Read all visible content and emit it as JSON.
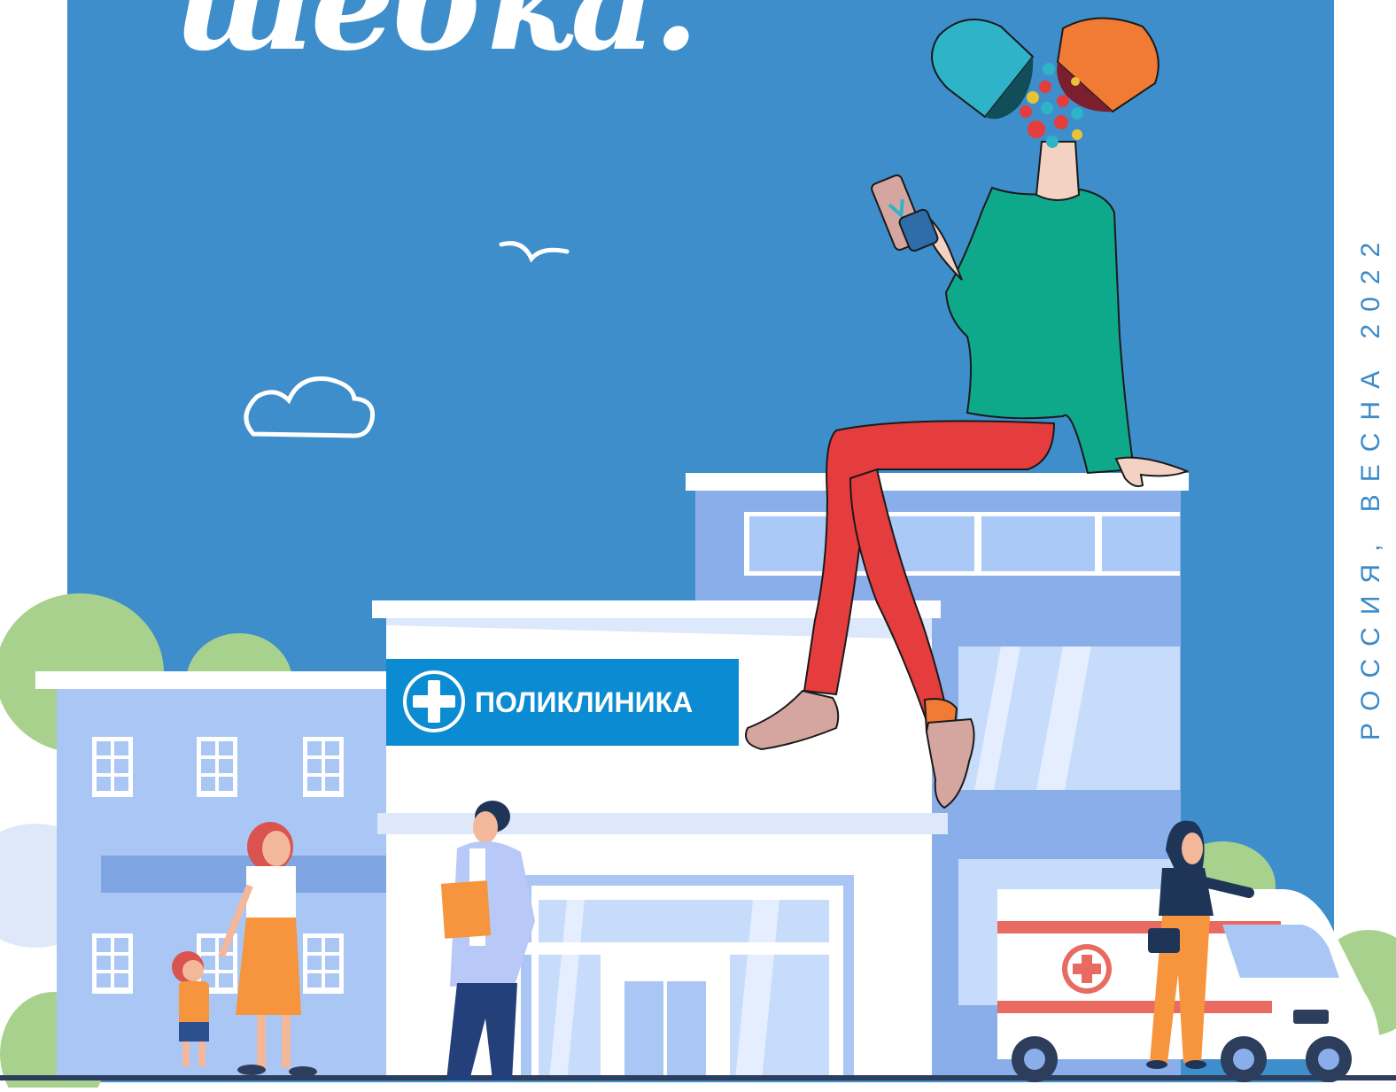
{
  "poster": {
    "brand_title": "шебка.",
    "side_caption": "РОССИЯ, ВЕСНА 2022",
    "clinic_sign": "ПОЛИКЛИНИКА"
  },
  "colors": {
    "sky": "#3d8ecb",
    "building_light": "#a9c6f4",
    "building_mid": "#8aaeea",
    "sign_blue": "#0b8bd1",
    "tree_green": "#a9d18e",
    "ground": "#2c3e5c",
    "sweater": "#0ea88b",
    "pants": "#e53d3d",
    "capsule_teal": "#2eb3c9",
    "capsule_orange": "#f17a35"
  },
  "icons": [
    "bird-icon",
    "cloud-icon",
    "medical-cross-icon",
    "pill-capsule-icon",
    "smartphone-icon"
  ]
}
